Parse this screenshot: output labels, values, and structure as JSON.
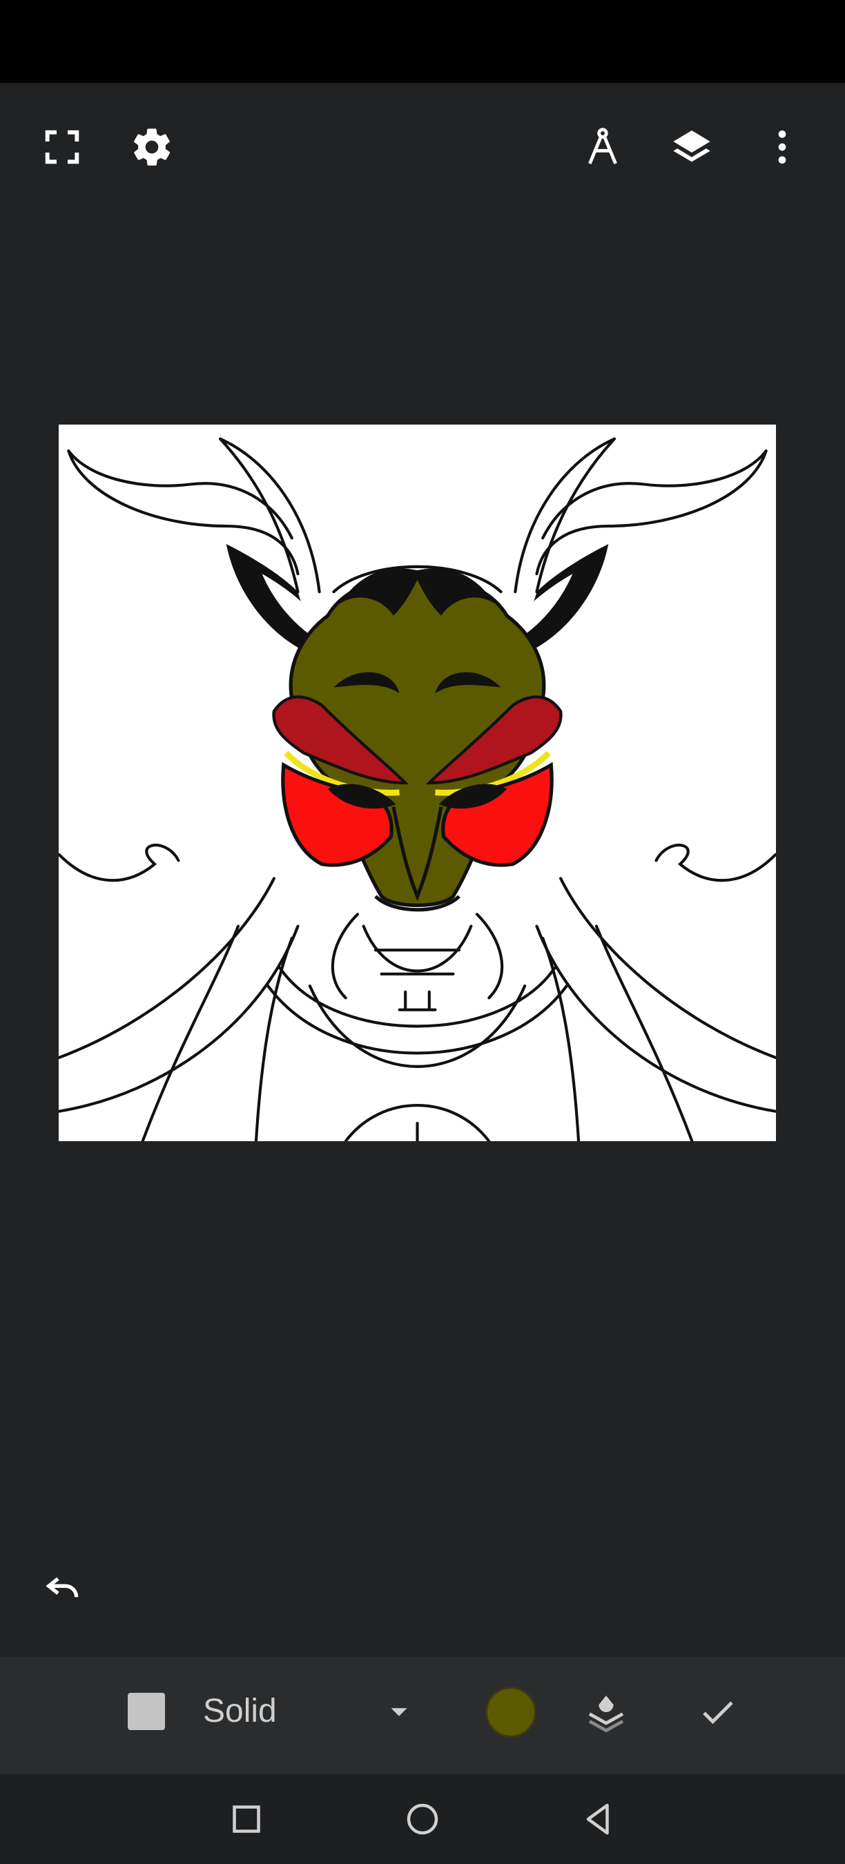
{
  "toolbar": {
    "icons": [
      "fullscreen-icon",
      "settings-icon",
      "compass-icon",
      "layers-icon",
      "more-vert-icon"
    ]
  },
  "canvas": {
    "fill_colors": {
      "face": "#5c5a00",
      "brow": "#b0151d",
      "cheek": "#fb0f0f",
      "eye_line": "#f1e416",
      "line": "#111111"
    }
  },
  "fill_toolbar": {
    "mode_label": "Solid",
    "selected_color": "#5c5a00"
  },
  "nav": {
    "icons": [
      "recents-icon",
      "home-icon",
      "back-icon"
    ]
  }
}
